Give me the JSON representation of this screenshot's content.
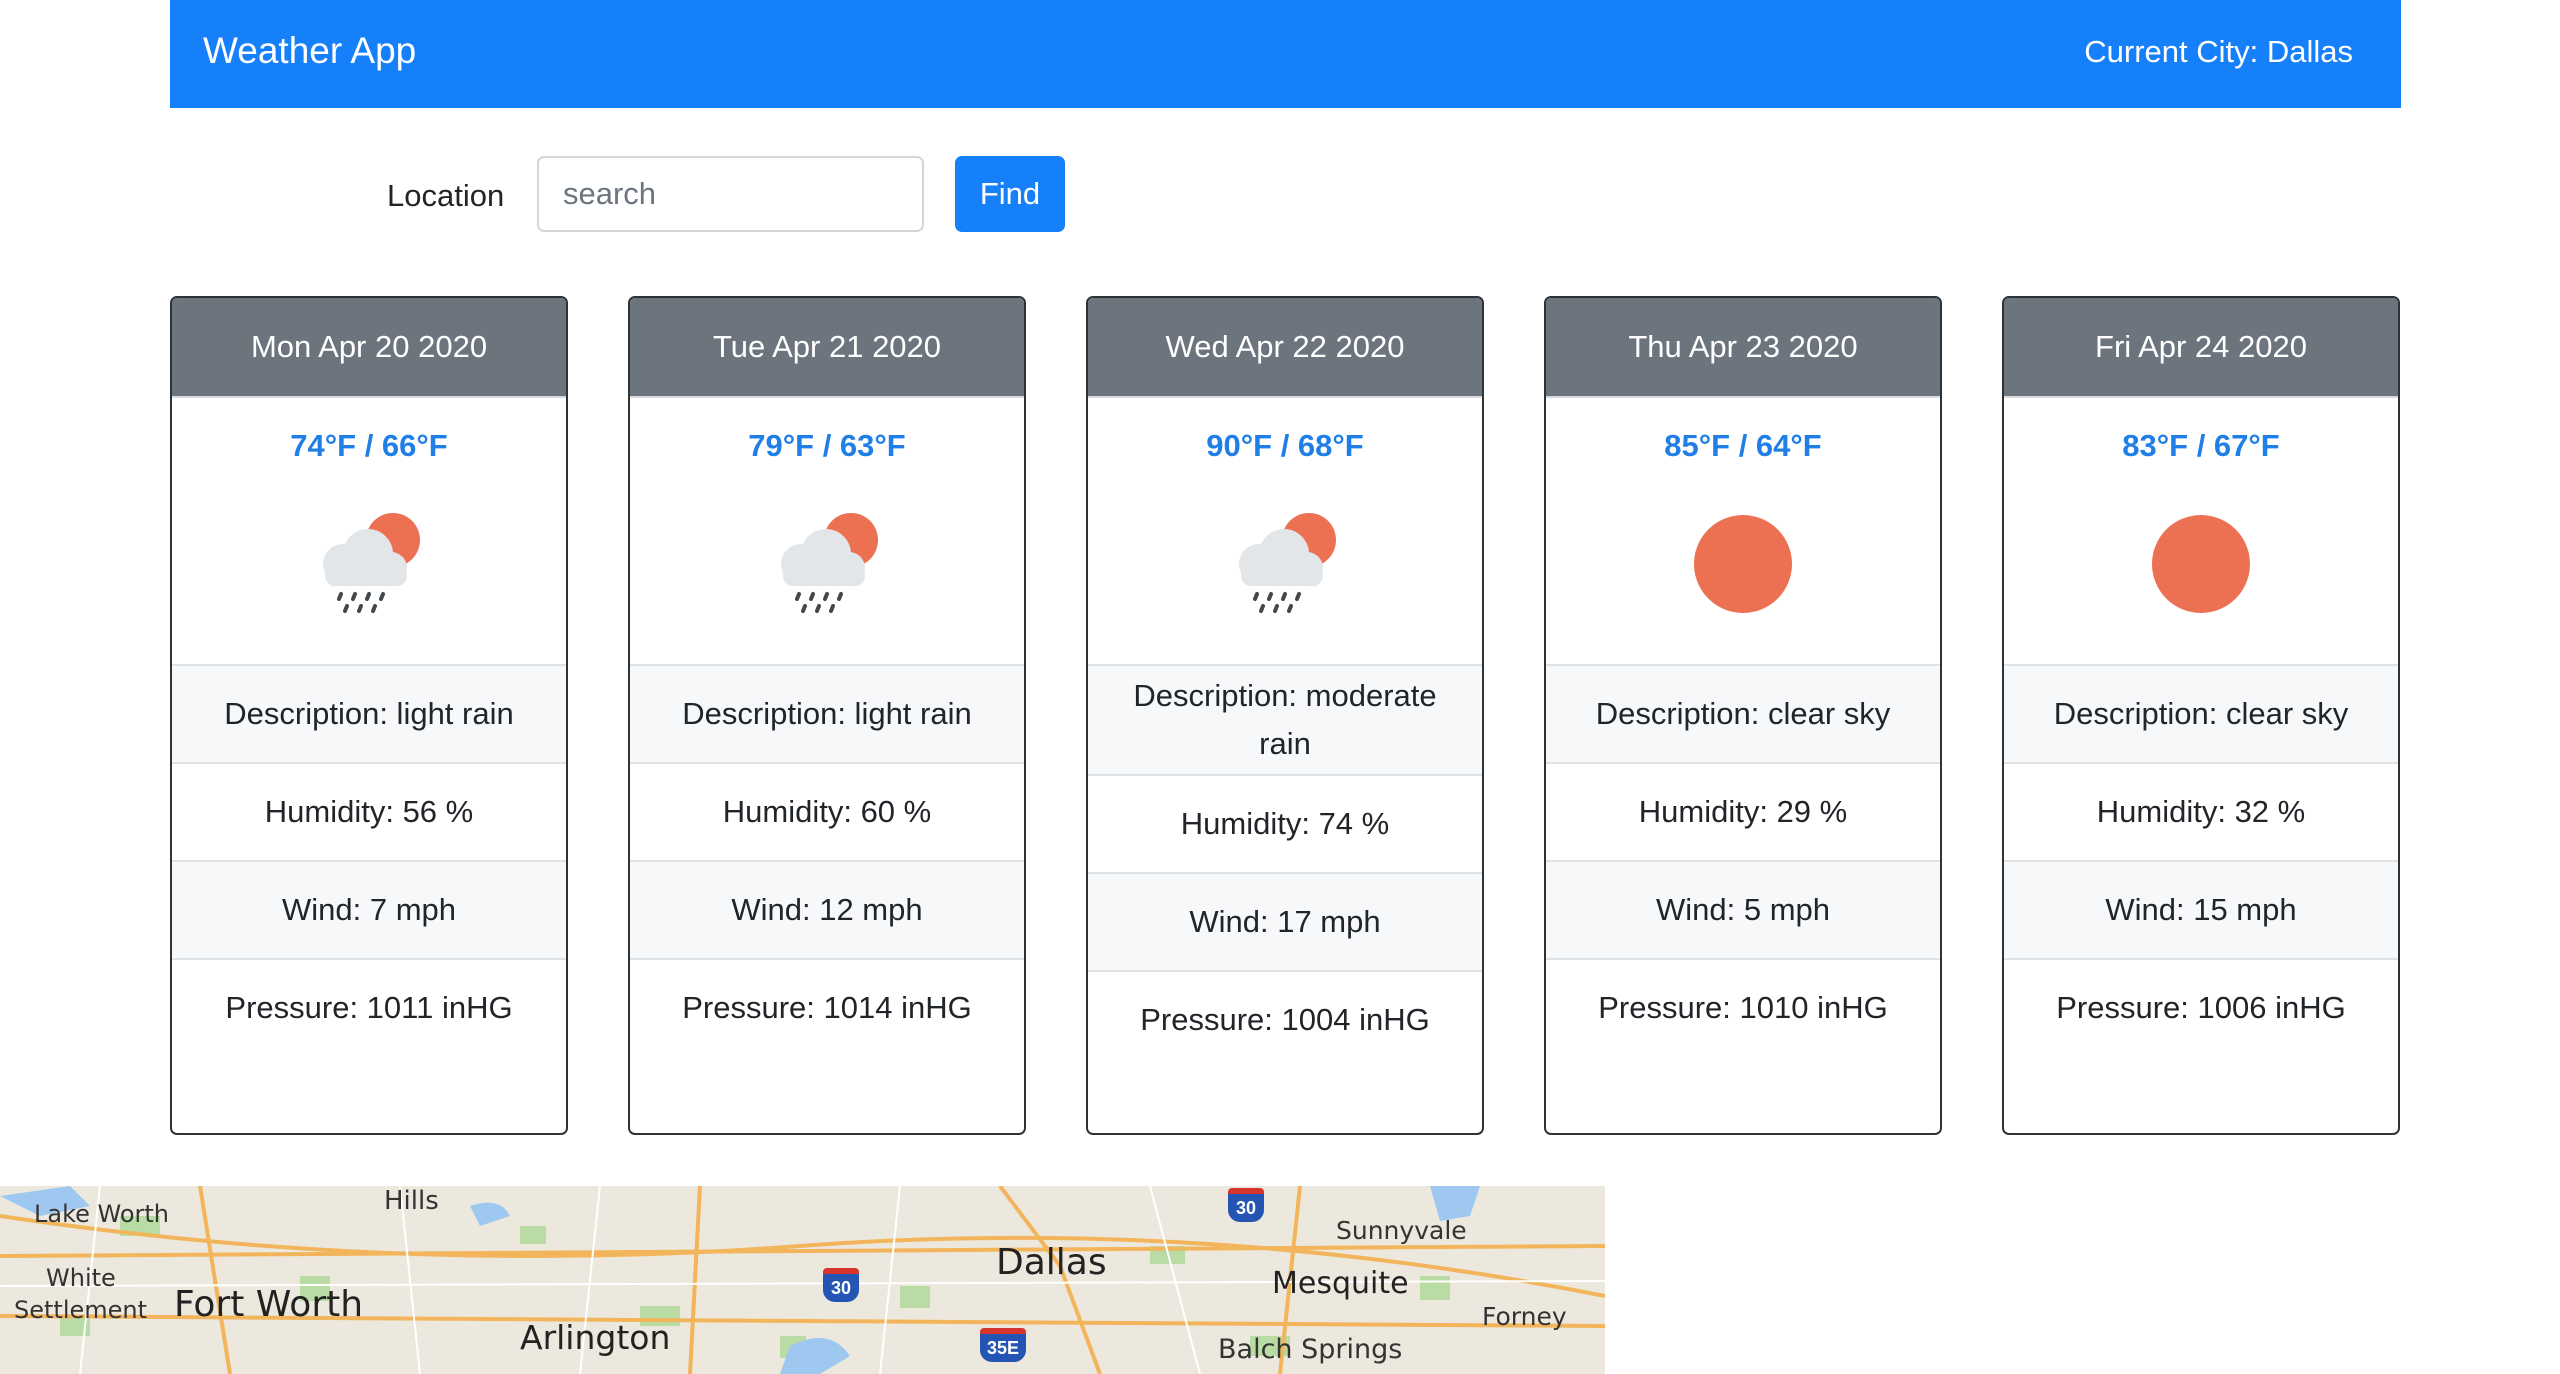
{
  "navbar": {
    "brand": "Weather App",
    "current_city": "Current City: Dallas"
  },
  "search": {
    "label": "Location",
    "placeholder": "search",
    "value": "",
    "button_label": "Find"
  },
  "forecast": [
    {
      "date": "Mon Apr 20 2020",
      "temp": "74°F / 66°F",
      "icon": "rain-sun-icon",
      "description": "Description: light rain",
      "humidity": "Humidity: 56 %",
      "wind": "Wind: 7 mph",
      "pressure": "Pressure: 1011 inHG"
    },
    {
      "date": "Tue Apr 21 2020",
      "temp": "79°F / 63°F",
      "icon": "rain-sun-icon",
      "description": "Description: light rain",
      "humidity": "Humidity: 60 %",
      "wind": "Wind: 12 mph",
      "pressure": "Pressure: 1014 inHG"
    },
    {
      "date": "Wed Apr 22 2020",
      "temp": "90°F / 68°F",
      "icon": "rain-sun-icon",
      "description": "Description: moderate rain",
      "humidity": "Humidity: 74 %",
      "wind": "Wind: 17 mph",
      "pressure": "Pressure: 1004 inHG"
    },
    {
      "date": "Thu Apr 23 2020",
      "temp": "85°F / 64°F",
      "icon": "sun-icon",
      "description": "Description: clear sky",
      "humidity": "Humidity: 29 %",
      "wind": "Wind: 5 mph",
      "pressure": "Pressure: 1010 inHG"
    },
    {
      "date": "Fri Apr 24 2020",
      "temp": "83°F / 67°F",
      "icon": "sun-icon",
      "description": "Description: clear sky",
      "humidity": "Humidity: 32 %",
      "wind": "Wind: 15 mph",
      "pressure": "Pressure: 1006 inHG"
    }
  ],
  "map": {
    "labels": {
      "lake_worth": "Lake Worth",
      "hills": "Hills",
      "white": "White",
      "settlement": "Settlement",
      "fort_worth": "Fort Worth",
      "arlington": "Arlington",
      "dallas": "Dallas",
      "sunnyvale": "Sunnyvale",
      "mesquite": "Mesquite",
      "forney": "Forney",
      "balch_springs": "Balch Springs"
    },
    "shields": {
      "i30_a": "30",
      "i30_b": "30",
      "i35e": "35E"
    }
  },
  "colors": {
    "primary": "#1580fa",
    "header_gray": "#6c757d",
    "temp_blue": "#1f7fe6",
    "sun": "#ec7052"
  }
}
